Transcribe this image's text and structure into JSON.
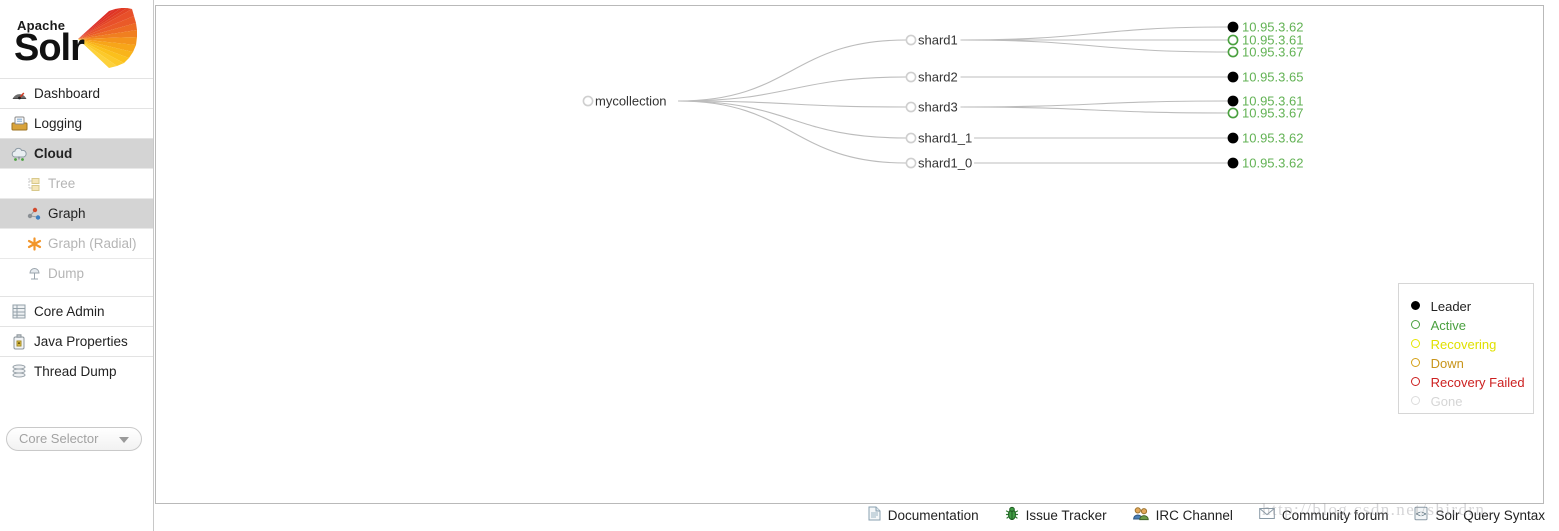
{
  "branding": {
    "logo_top": "Apache",
    "logo_main": "Solr",
    "logo_icon": "solr-sunburst-logo"
  },
  "sidebar": {
    "items": [
      {
        "label": "Dashboard",
        "icon": "dashboard-gauge-icon",
        "active": false
      },
      {
        "label": "Logging",
        "icon": "logging-tray-icon",
        "active": false
      },
      {
        "label": "Cloud",
        "icon": "cloud-icon",
        "active": true
      }
    ],
    "cloud_subitems": [
      {
        "label": "Tree",
        "icon": "tree-icon",
        "enabled": false,
        "selected": false
      },
      {
        "label": "Graph",
        "icon": "graph-icon",
        "enabled": true,
        "selected": true
      },
      {
        "label": "Graph (Radial)",
        "icon": "radial-icon",
        "enabled": false,
        "selected": false
      },
      {
        "label": "Dump",
        "icon": "dump-icon",
        "enabled": false,
        "selected": false
      }
    ],
    "bottom_items": [
      {
        "label": "Core Admin",
        "icon": "core-admin-icon"
      },
      {
        "label": "Java Properties",
        "icon": "java-properties-icon"
      },
      {
        "label": "Thread Dump",
        "icon": "thread-dump-icon"
      }
    ],
    "core_selector": {
      "placeholder": "Core Selector",
      "icon": "chevron-down-icon"
    }
  },
  "graph": {
    "root": {
      "label": "mycollection",
      "status": "gone"
    },
    "shards": [
      {
        "label": "shard1",
        "replicas": [
          {
            "label": "10.95.3.62",
            "status": "leader"
          },
          {
            "label": "10.95.3.61",
            "status": "active"
          },
          {
            "label": "10.95.3.67",
            "status": "active"
          }
        ]
      },
      {
        "label": "shard2",
        "replicas": [
          {
            "label": "10.95.3.65",
            "status": "leader"
          }
        ]
      },
      {
        "label": "shard3",
        "replicas": [
          {
            "label": "10.95.3.61",
            "status": "leader"
          },
          {
            "label": "10.95.3.67",
            "status": "active"
          }
        ]
      },
      {
        "label": "shard1_1",
        "replicas": [
          {
            "label": "10.95.3.62",
            "status": "leader"
          }
        ]
      },
      {
        "label": "shard1_0",
        "replicas": [
          {
            "label": "10.95.3.62",
            "status": "leader"
          }
        ]
      }
    ]
  },
  "legend": {
    "rows": [
      {
        "label": "Leader",
        "color": "#000000",
        "filled": true,
        "text_color": "#222222"
      },
      {
        "label": "Active",
        "color": "#4aa03f",
        "filled": false,
        "text_color": "#4aa03f"
      },
      {
        "label": "Recovering",
        "color": "#e6e600",
        "filled": false,
        "text_color": "#e0e000"
      },
      {
        "label": "Down",
        "color": "#d4a017",
        "filled": false,
        "text_color": "#c8941a"
      },
      {
        "label": "Recovery Failed",
        "color": "#cc1f1f",
        "filled": false,
        "text_color": "#cc1f1f"
      },
      {
        "label": "Gone",
        "color": "#dcdcdc",
        "filled": false,
        "text_color": "#d5d5d5"
      }
    ]
  },
  "footer": {
    "links": [
      {
        "label": "Documentation",
        "icon": "document-icon"
      },
      {
        "label": "Issue Tracker",
        "icon": "bug-icon"
      },
      {
        "label": "IRC Channel",
        "icon": "people-icon"
      },
      {
        "label": "Community forum",
        "icon": "envelope-icon"
      },
      {
        "label": "Solr Query Syntax",
        "icon": "code-brackets-icon"
      }
    ]
  },
  "watermark": {
    "text": "http://blog.csdn.net/shirdrn"
  },
  "colors": {
    "active_green": "#62b254",
    "leader_black": "#000000",
    "edge_gray": "#bcbcbc",
    "sidebar_active_bg": "#d4d4d4"
  }
}
